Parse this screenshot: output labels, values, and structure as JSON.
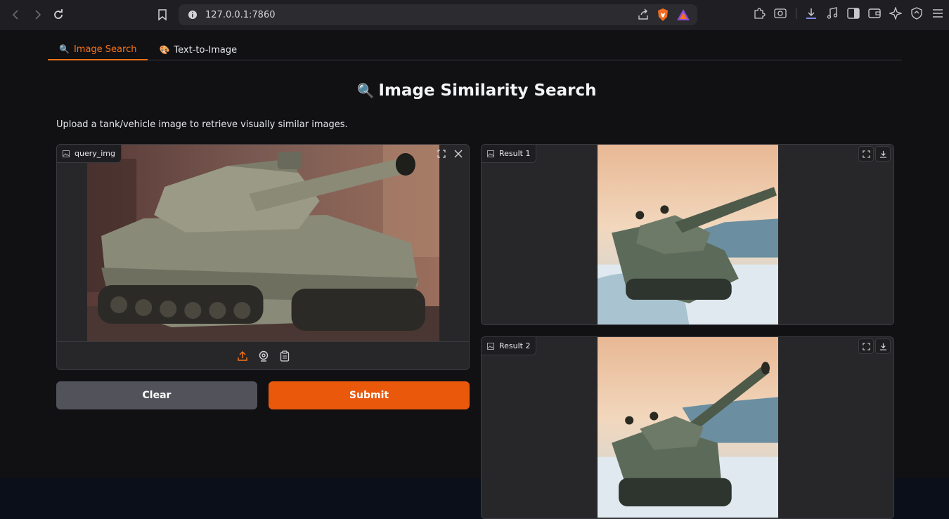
{
  "browser": {
    "url": "127.0.0.1:7860"
  },
  "tabs": [
    {
      "label": "Image Search",
      "emoji": "🔍",
      "active": true
    },
    {
      "label": "Text-to-Image",
      "emoji": "🎨",
      "active": false
    }
  ],
  "page": {
    "title": "Image Similarity Search",
    "title_emoji": "🔍",
    "description": "Upload a tank/vehicle image to retrieve visually similar images."
  },
  "query": {
    "label": "query_img"
  },
  "buttons": {
    "clear": "Clear",
    "submit": "Submit"
  },
  "results": [
    {
      "label": "Result 1"
    },
    {
      "label": "Result 2"
    }
  ],
  "colors": {
    "accent": "#ea580c",
    "tab_active": "#f97316",
    "background": "#111114",
    "panel": "#27272a"
  }
}
